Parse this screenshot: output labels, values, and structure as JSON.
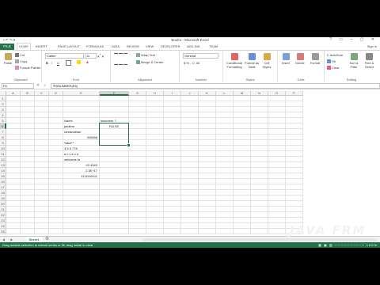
{
  "window": {
    "title": "Book1 - Microsoft Excel",
    "controls": "? ▭ – ▢ ✕"
  },
  "quick_access": "▪ ↶ ↷ ▾",
  "ribbon_tabs": {
    "file": "FILE",
    "tabs": [
      "HOME",
      "INSERT",
      "PAGE LAYOUT",
      "FORMULAS",
      "DATA",
      "REVIEW",
      "VIEW",
      "DEVELOPER",
      "ADD-INS",
      "TEAM"
    ],
    "active": "HOME",
    "sign_in": "Sign in"
  },
  "ribbon": {
    "clipboard": {
      "label": "Clipboard",
      "paste": "Paste",
      "cut": "Cut",
      "copy": "Copy",
      "format_painter": "Format Painter"
    },
    "font": {
      "label": "Font",
      "family": "Calibri",
      "size": "11",
      "bold": "B",
      "italic": "I",
      "underline": "U"
    },
    "alignment": {
      "label": "Alignment",
      "wrap_text": "Wrap Text",
      "merge_center": "Merge & Center"
    },
    "number": {
      "label": "Number",
      "format": "General",
      "symbols": "$ % , .0 .00"
    },
    "styles": {
      "label": "Styles",
      "conditional": "Conditional Formatting",
      "format_table": "Format as Table",
      "cell_styles": "Cell Styles"
    },
    "cells": {
      "label": "Cells",
      "insert": "Insert",
      "delete": "Delete",
      "format": "Format"
    },
    "editing": {
      "label": "Editing",
      "autosum": "AutoSum",
      "fill": "Fill",
      "clear": "Clear",
      "sort_filter": "Sort & Filter",
      "find_select": "Find & Select"
    }
  },
  "formula_bar": {
    "name_box": "F6",
    "icons": "✕ ✓ fx",
    "formula": "=ISNUMBER(E6)"
  },
  "grid": {
    "columns": [
      "A",
      "B",
      "C",
      "D",
      "E",
      "F",
      "G",
      "H",
      "I",
      "J",
      "K",
      "L",
      "M",
      "N",
      "O",
      "P"
    ],
    "rows": [
      "1",
      "2",
      "3",
      "4",
      "5",
      "6",
      "7",
      "8",
      "9",
      "10",
      "11",
      "12",
      "13",
      "14",
      "15",
      "16",
      "17",
      "18",
      "19",
      "20",
      "21",
      "22",
      "23",
      "24",
      "25"
    ],
    "selected_column": "F",
    "selected_row": "6",
    "cells": {
      "E5": "Name",
      "F5": "isnumber ?",
      "E6": "javafrm",
      "F6": "FALSE",
      "E7": "ramanathan",
      "E8": "345656",
      "E9": "%&&**",
      "E10": "3 5 6 778",
      "E11": "a c v e v e",
      "E12": "welcome to",
      "E13": "22.4543",
      "E14": "2.3E+17",
      "E15": "1111000111"
    }
  },
  "sheet_tabs": {
    "nav": "◀ ▶ ...",
    "sheets": [
      "Sheet1"
    ],
    "add": "⊕"
  },
  "status": {
    "message": "Drag outside selection to extend series or fill; drag inside to clear",
    "right": "▦ ▣ ▥ ─────────+ 100%"
  },
  "watermark": "JAVA FRM",
  "colors": {
    "excel_green": "#217346"
  }
}
